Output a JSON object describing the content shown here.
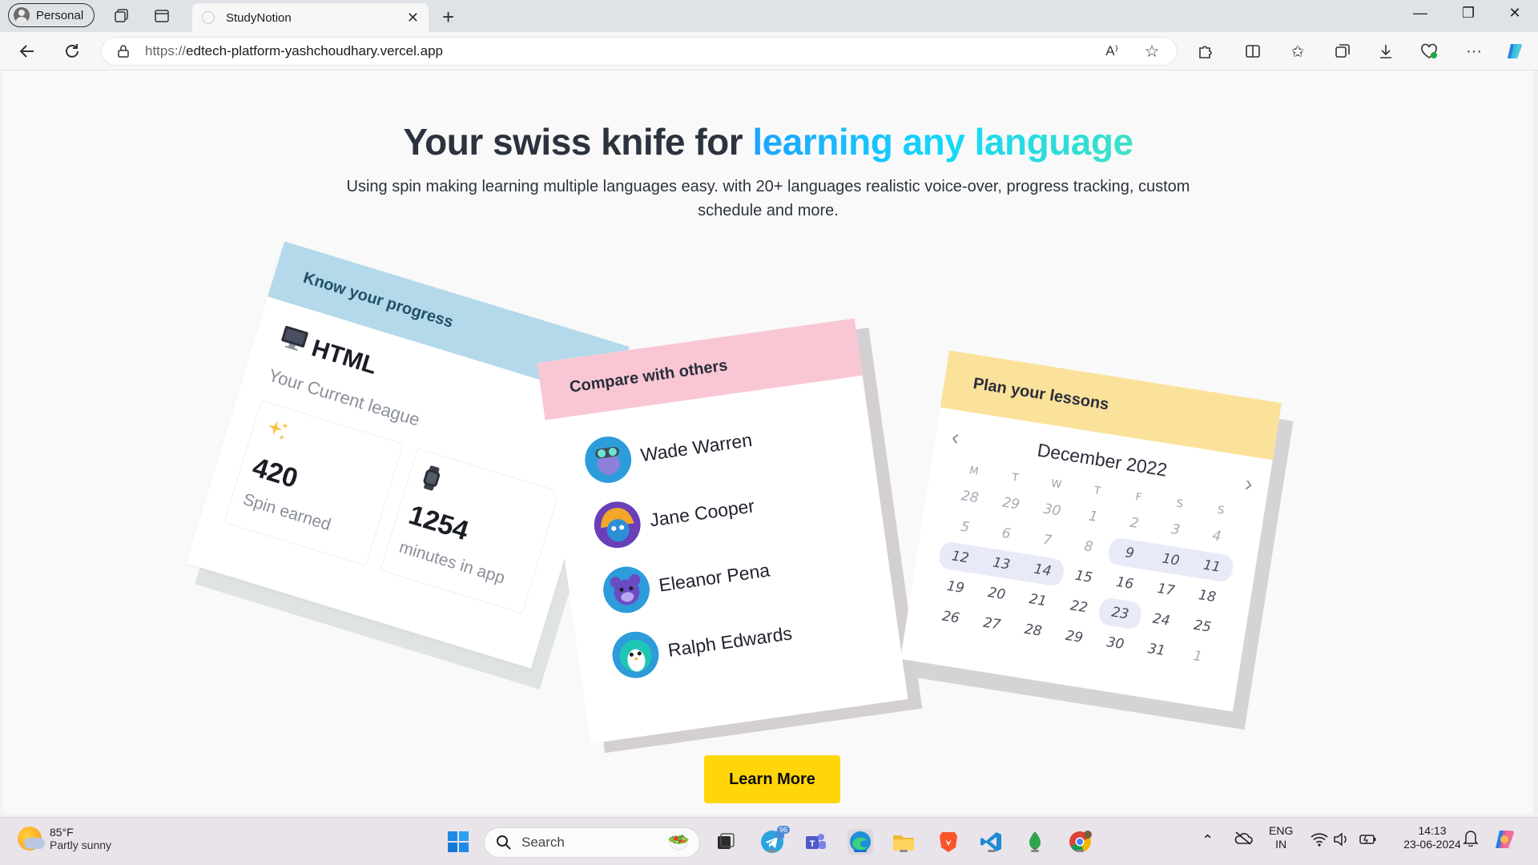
{
  "browser": {
    "profile_label": "Personal",
    "tab_title": "StudyNotion",
    "url_protocol": "https://",
    "url_host": "edtech-platform-yashchoudhary.vercel.app"
  },
  "hero": {
    "headline_plain": "Your swiss knife for ",
    "headline_highlight": "learning any language",
    "subtitle": "Using spin making learning multiple languages easy. with 20+ languages realistic voice-over, progress tracking, custom schedule and more.",
    "cta_label": "Learn More",
    "highlight_gradient": [
      "#1fa2ff",
      "#12d8fa",
      "#3fe0c5"
    ],
    "cta_color": "#ffd60a"
  },
  "progress_card": {
    "title": "Know your progress",
    "language": "HTML",
    "league_label": "Your Current league",
    "stats": [
      {
        "value": "420",
        "label": "Spin earned",
        "icon": "sparkles-icon"
      },
      {
        "value": "1254",
        "label": "minutes in app",
        "icon": "watch-icon"
      }
    ],
    "header_color": "#b3d9ea"
  },
  "compare_card": {
    "title": "Compare with others",
    "people": [
      "Wade Warren",
      "Jane Cooper",
      "Eleanor Pena",
      "Ralph Edwards"
    ],
    "header_color": "#f9c7d4"
  },
  "lessons_card": {
    "title": "Plan your lessons",
    "month": "December 2022",
    "weekdays": [
      "M",
      "T",
      "W",
      "T",
      "F",
      "S",
      "S"
    ],
    "weeks": [
      [
        "28",
        "29",
        "30",
        "1",
        "2",
        "3",
        "4"
      ],
      [
        "5",
        "6",
        "7",
        "8",
        "9",
        "10",
        "11"
      ],
      [
        "12",
        "13",
        "14",
        "15",
        "16",
        "17",
        "18"
      ],
      [
        "19",
        "20",
        "21",
        "22",
        "23",
        "24",
        "25"
      ],
      [
        "26",
        "27",
        "28",
        "29",
        "30",
        "31",
        "1"
      ]
    ],
    "header_color": "#fbe29a"
  },
  "taskbar": {
    "weather_temp": "85°F",
    "weather_condition": "Partly sunny",
    "search_placeholder": "Search",
    "language_top": "ENG",
    "language_bottom": "IN",
    "time": "14:13",
    "date": "23-06-2024",
    "telegram_badge": "96"
  }
}
